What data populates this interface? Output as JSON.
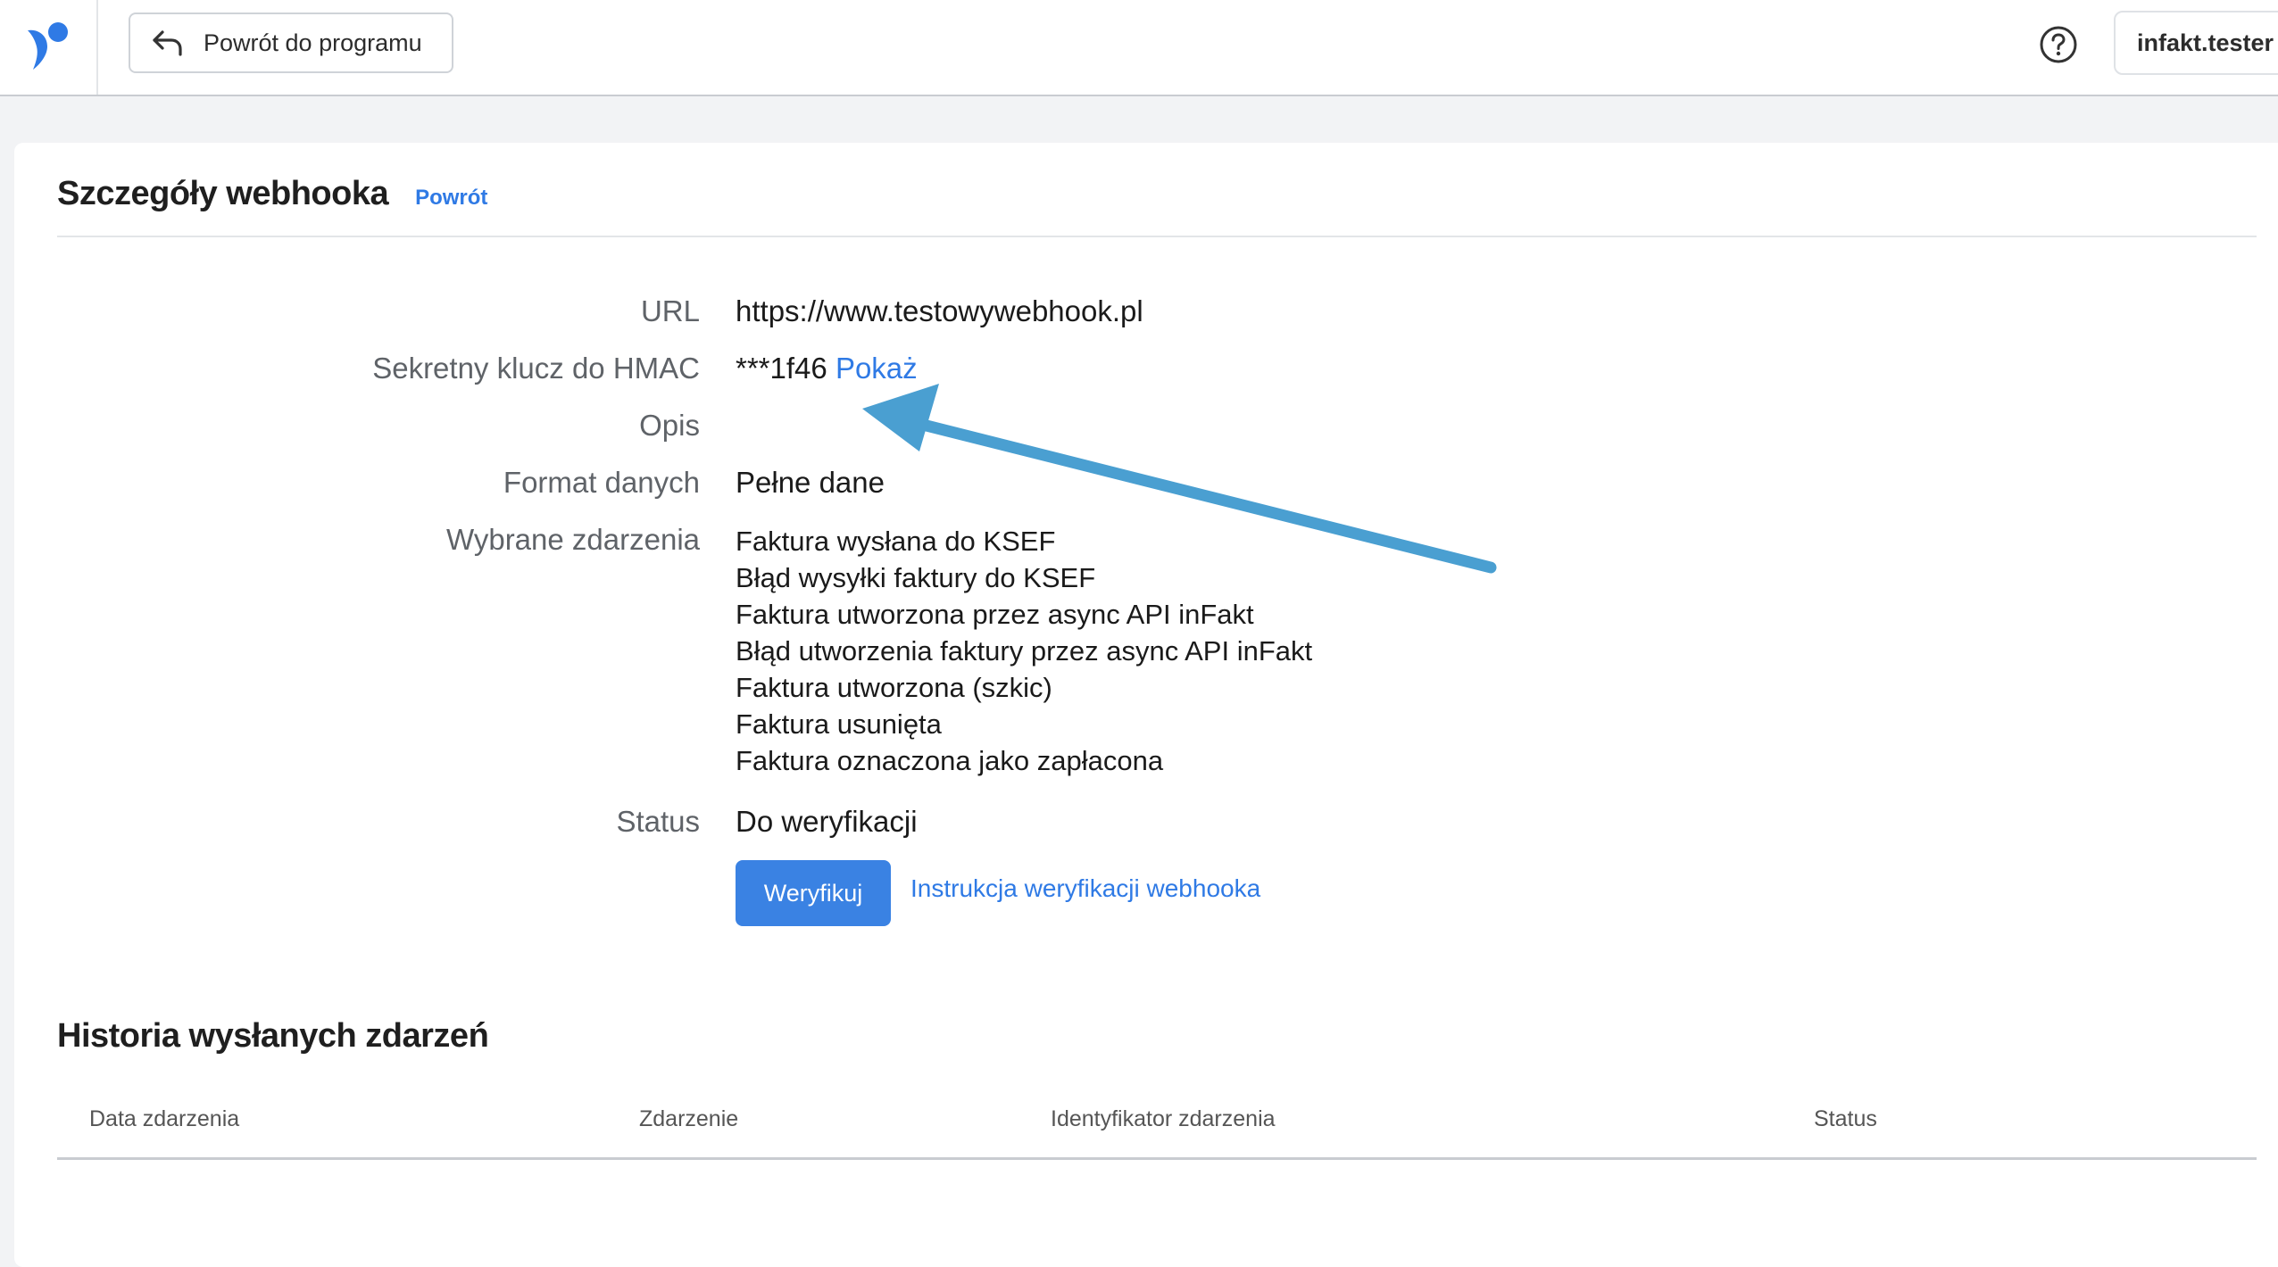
{
  "header": {
    "back_button_label": "Powrót do programu",
    "user_label": "infakt.tester",
    "icons": [
      "infakt-logo-icon",
      "undo-arrow-icon",
      "help-circle-icon"
    ],
    "brand_color": "#2f7ae5"
  },
  "page": {
    "title": "Szczegóły webhooka",
    "back_link": "Powrót"
  },
  "details": {
    "url_label": "URL",
    "url_value": "https://www.testowywebhook.pl",
    "hmac_label": "Sekretny klucz do HMAC",
    "hmac_value": "***1f46",
    "hmac_show_link": "Pokaż",
    "description_label": "Opis",
    "description_value": "",
    "format_label": "Format danych",
    "format_value": "Pełne dane",
    "events_label": "Wybrane zdarzenia",
    "events": [
      "Faktura wysłana do KSEF",
      "Błąd wysyłki faktury do KSEF",
      "Faktura utworzona przez async API inFakt",
      "Błąd utworzenia faktury przez async API inFakt",
      "Faktura utworzona (szkic)",
      "Faktura usunięta",
      "Faktura oznaczona jako zapłacona"
    ],
    "status_label": "Status",
    "status_value": "Do weryfikacji",
    "verify_button": "Weryfikuj",
    "verify_instructions_link": "Instrukcja weryfikacji webhooka"
  },
  "annotation": {
    "arrow_color": "#4a9fd1"
  },
  "history": {
    "title": "Historia wysłanych zdarzeń",
    "columns": [
      "Data zdarzenia",
      "Zdarzenie",
      "Identyfikator zdarzenia",
      "Status"
    ]
  }
}
